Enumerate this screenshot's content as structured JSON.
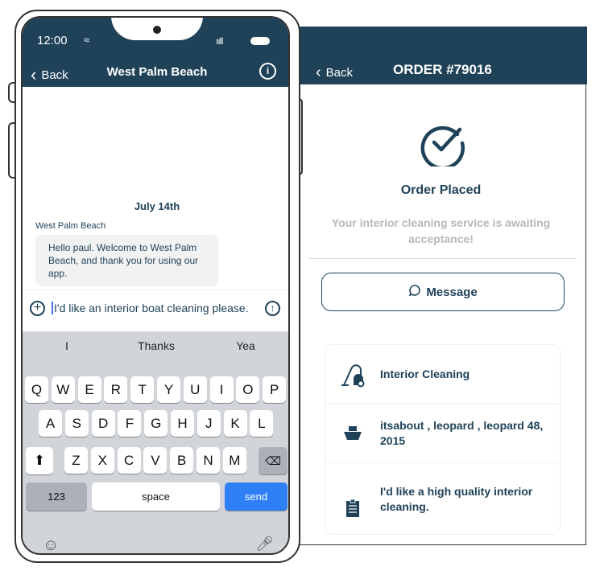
{
  "order": {
    "back": "Back",
    "title": "ORDER #79016",
    "status": "Order Placed",
    "subtitle": "Your interior cleaning service is awaiting acceptance!",
    "message_button": "Message",
    "details": [
      {
        "icon": "vacuum-icon",
        "text": "Interior Cleaning"
      },
      {
        "icon": "boat-icon",
        "text": "itsabout , leopard , leopard 48, 2015"
      },
      {
        "icon": "clipboard-icon",
        "text": "I'd like a high quality interior cleaning."
      }
    ]
  },
  "chat": {
    "time": "12:00",
    "back": "Back",
    "title": "West Palm Beach",
    "date": "July 14th",
    "sender": "West Palm Beach",
    "message": "Hello paul. Welcome to West Palm Beach, and thank you for using our app.",
    "input": "I'd like an interior boat cleaning please."
  },
  "keyboard": {
    "suggestions": [
      "I",
      "Thanks",
      "Yea"
    ],
    "rows": [
      [
        "Q",
        "W",
        "E",
        "R",
        "T",
        "Y",
        "U",
        "I",
        "O",
        "P"
      ],
      [
        "A",
        "S",
        "D",
        "F",
        "G",
        "H",
        "J",
        "K",
        "L"
      ],
      [
        "Z",
        "X",
        "C",
        "V",
        "B",
        "N",
        "M"
      ]
    ],
    "numbers": "123",
    "space": "space",
    "send": "send"
  },
  "colors": {
    "primary": "#1f4259",
    "send": "#2f80f7",
    "keyboard": "#d1d4d9"
  }
}
